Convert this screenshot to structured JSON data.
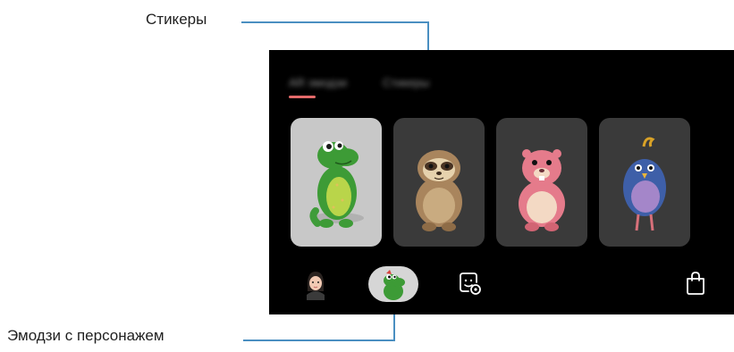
{
  "callouts": {
    "stickers": "Стикеры",
    "character_emoji": "Эмодзи с персонажем"
  },
  "screen": {
    "tabs": [
      {
        "label": "AR эмодзи",
        "active": true
      },
      {
        "label": "Стикеры",
        "active": false
      }
    ],
    "cards": [
      {
        "name": "green-dinosaur",
        "selected": true
      },
      {
        "name": "sloth",
        "selected": false
      },
      {
        "name": "pink-beaver",
        "selected": false
      },
      {
        "name": "blue-bird",
        "selected": false
      }
    ],
    "bottom_bar": {
      "items": [
        {
          "icon": "my-emoji-avatar-icon"
        },
        {
          "icon": "character-emoji-icon",
          "selected": true
        },
        {
          "icon": "sticker-settings-icon"
        },
        {
          "icon": "store-bag-icon"
        }
      ]
    }
  },
  "colors": {
    "leader_line": "#4a8fc1",
    "tab_indicator": "#e46a6a",
    "selected_card": "#c8c8c8",
    "card": "#3a3a3a"
  }
}
